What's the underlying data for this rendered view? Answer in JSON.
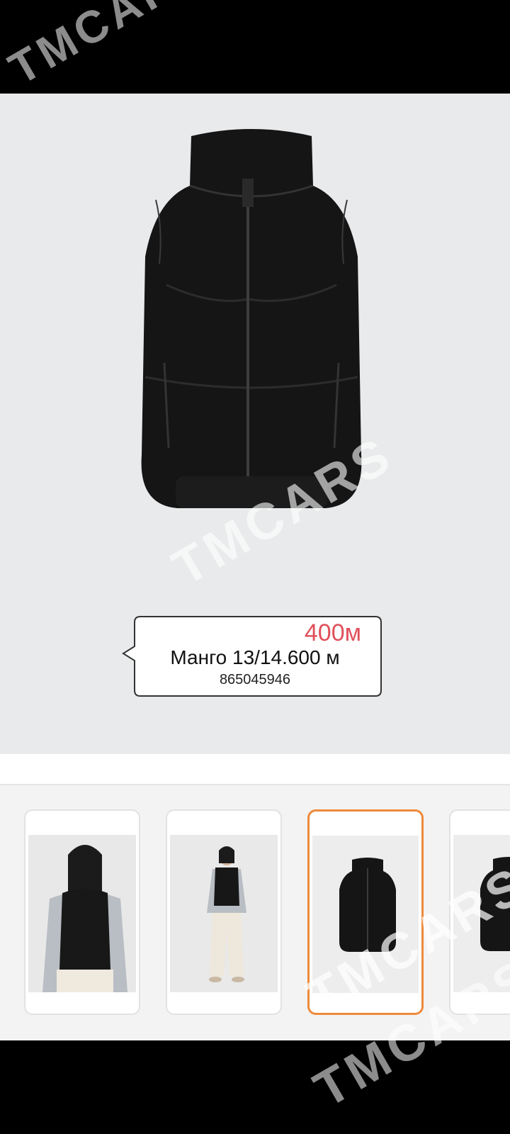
{
  "watermark": "TMCARS",
  "listing": {
    "price": "400м",
    "title": "Манго 13/14.600 м",
    "phone": "865045946"
  },
  "gallery": {
    "selected_index": 2,
    "thumbnails": [
      {
        "subject": "girl-wearing-vest-closeup"
      },
      {
        "subject": "girl-wearing-vest-full"
      },
      {
        "subject": "vest-front"
      },
      {
        "subject": "vest-back"
      }
    ]
  },
  "colors": {
    "price": "#e0505a",
    "selected_border": "#ee8a3c",
    "background": "#e9eaeb"
  }
}
